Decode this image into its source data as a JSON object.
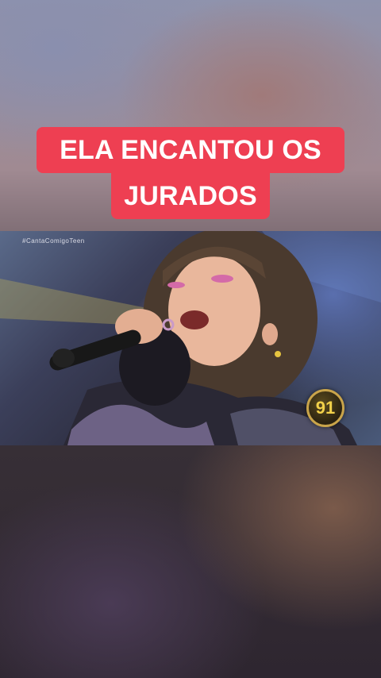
{
  "caption": {
    "line1": "ELA ENCANTOU OS",
    "line2": "JURADOS"
  },
  "video": {
    "hashtag": "#CantaComigoTeen",
    "score": "91"
  },
  "colors": {
    "caption_bg": "#ee3f52",
    "caption_text": "#ffffff",
    "score_text": "#f2d14a",
    "score_ring": "#c9a44a"
  }
}
